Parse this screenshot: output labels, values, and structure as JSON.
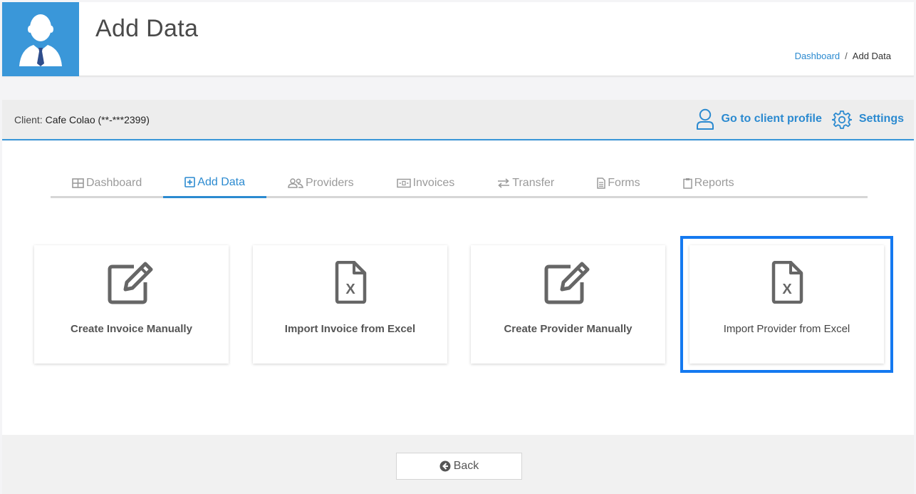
{
  "header": {
    "title": "Add Data",
    "breadcrumb": {
      "home": "Dashboard",
      "separator": "/",
      "current": "Add Data"
    },
    "avatar_icon": "user-tie-icon",
    "avatar_bg": "#3a97d9"
  },
  "client_bar": {
    "label": "Client:",
    "client_name": "Cafe Colao (**-***2399)",
    "profile_link": "Go to client profile",
    "profile_icon": "user-outline-icon",
    "settings_link": "Settings",
    "settings_icon": "gear-icon"
  },
  "tabs": [
    {
      "label": "Dashboard",
      "icon": "table-icon",
      "active": false
    },
    {
      "label": "Add Data",
      "icon": "plus-square-icon",
      "active": true
    },
    {
      "label": "Providers",
      "icon": "users-icon",
      "active": false
    },
    {
      "label": "Invoices",
      "icon": "money-bill-icon",
      "active": false
    },
    {
      "label": "Transfer",
      "icon": "exchange-icon",
      "active": false
    },
    {
      "label": "Forms",
      "icon": "file-text-icon",
      "active": false
    },
    {
      "label": "Reports",
      "icon": "clipboard-icon",
      "active": false
    }
  ],
  "cards": [
    {
      "label": "Create Invoice Manually",
      "icon": "edit-icon"
    },
    {
      "label": "Import Invoice from Excel",
      "icon": "file-excel-icon"
    },
    {
      "label": "Create Provider Manually",
      "icon": "edit-icon"
    },
    {
      "label": "Import Provider from Excel",
      "icon": "file-excel-icon",
      "highlighted": true
    }
  ],
  "footer": {
    "back_label": "Back",
    "back_icon": "arrow-circle-left-icon"
  },
  "colors": {
    "accent": "#2b8ad0",
    "highlight_border": "#1479f0"
  }
}
